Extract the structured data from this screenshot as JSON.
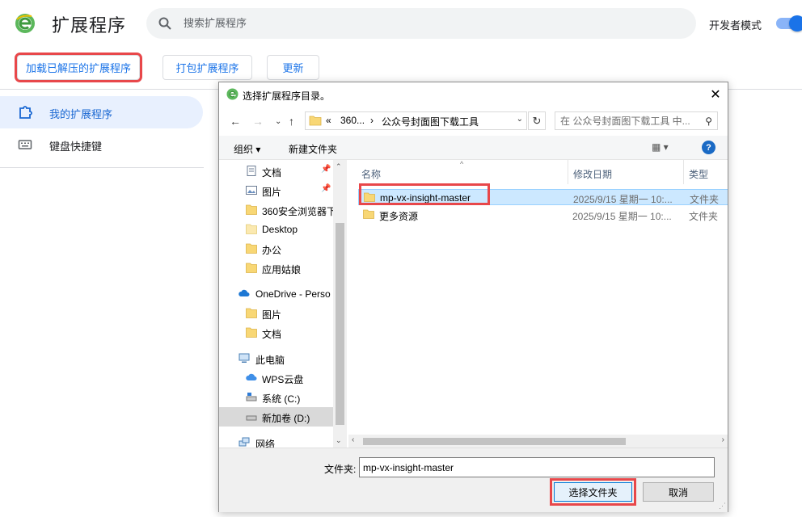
{
  "page": {
    "title": "扩展程序",
    "search_placeholder": "搜索扩展程序",
    "dev_mode_label": "开发者模式",
    "dev_mode_on": true,
    "accent_color": "#1a73e8"
  },
  "toolbar": {
    "load_unpacked": "加载已解压的扩展程序",
    "pack": "打包扩展程序",
    "update": "更新"
  },
  "sidebar": {
    "items": [
      {
        "label": "我的扩展程序",
        "icon": "puzzle-icon",
        "active": true
      },
      {
        "label": "键盘快捷键",
        "icon": "keyboard-icon",
        "active": false
      }
    ]
  },
  "dialog": {
    "title": "选择扩展程序目录。",
    "close": "✕",
    "breadcrumb": {
      "prefix": "«",
      "parent": "360...",
      "sep": "›",
      "current": "公众号封面图下载工具"
    },
    "search_placeholder": "在 公众号封面图下载工具 中...",
    "commands": {
      "organize": "组织 ▾",
      "new_folder": "新建文件夹",
      "view": "▦ ▾",
      "help": "?"
    },
    "tree": [
      {
        "label": "文档",
        "icon": "documents-icon",
        "pinned": true
      },
      {
        "label": "图片",
        "icon": "pictures-icon",
        "pinned": true
      },
      {
        "label": "360安全浏览器下",
        "icon": "folder-icon"
      },
      {
        "label": "Desktop",
        "icon": "folder-icon"
      },
      {
        "label": "办公",
        "icon": "folder-icon"
      },
      {
        "label": "应用姑娘",
        "icon": "folder-icon"
      },
      {
        "label": "OneDrive - Perso",
        "icon": "cloud-icon"
      },
      {
        "label": "图片",
        "icon": "folder-icon"
      },
      {
        "label": "文档",
        "icon": "folder-icon"
      },
      {
        "label": "此电脑",
        "icon": "computer-icon"
      },
      {
        "label": "WPS云盘",
        "icon": "cloud-icon"
      },
      {
        "label": "系统 (C:)",
        "icon": "drive-icon"
      },
      {
        "label": "新加卷 (D:)",
        "icon": "drive-icon",
        "selected": true
      },
      {
        "label": "网络",
        "icon": "network-icon"
      }
    ],
    "columns": [
      "名称",
      "修改日期",
      "类型"
    ],
    "files": [
      {
        "name": "mp-vx-insight-master",
        "date": "2025/9/15 星期一 10:...",
        "type": "文件夹",
        "selected": true
      },
      {
        "name": "更多资源",
        "date": "2025/9/15 星期一 10:...",
        "type": "文件夹",
        "selected": false
      }
    ],
    "folder_label": "文件夹:",
    "folder_value": "mp-vx-insight-master",
    "select_button": "选择文件夹",
    "cancel_button": "取消"
  }
}
